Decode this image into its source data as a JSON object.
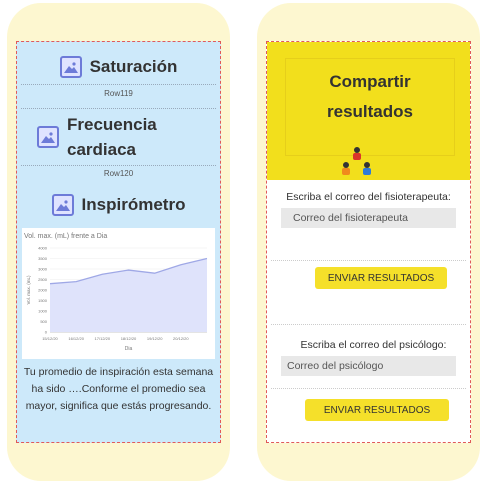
{
  "left": {
    "sections": [
      {
        "title": "Saturación",
        "row": "Row119"
      },
      {
        "title": "Frecuencia cardiaca",
        "row": "Row120"
      },
      {
        "title": "Inspirómetro"
      }
    ],
    "summary": "Tu promedio de inspiración esta semana ha sido ….Conforme el promedio sea mayor, significa que estás progresando."
  },
  "right": {
    "share_title": "Compartir resultados",
    "physio_label": "Escriba el correo del fisioterapeuta:",
    "physio_placeholder": "Correo del fisioterapeuta",
    "send_label": "ENVIAR RESULTADOS",
    "psych_label": "Escriba el correo del psicólogo:",
    "psych_placeholder": "Correo del psicólogo",
    "people_icon": "people-icon"
  },
  "colors": {
    "accent_yellow": "#f2df1c",
    "left_bg": "#cde9fa",
    "phone_bg": "#fdf7d0",
    "chart_line": "#9fa8e6"
  },
  "chart_data": {
    "type": "area",
    "title": "Vol. max. (mL) frente a Dia",
    "xlabel": "Dia",
    "ylabel": "Vol. max. (mL)",
    "categories": [
      "15/12/20",
      "16/12/20",
      "17/12/20",
      "18/12/20",
      "19/12/20",
      "20/12/20"
    ],
    "y_ticks": [
      "0",
      "500",
      "1000",
      "1500",
      "2000",
      "2500",
      "3000",
      "3500",
      "4000"
    ],
    "ylim": [
      0,
      4000
    ],
    "x": [
      0,
      1,
      2,
      3,
      4,
      5,
      6
    ],
    "values": [
      2300,
      2400,
      2750,
      2950,
      2800,
      3200,
      3500
    ]
  }
}
